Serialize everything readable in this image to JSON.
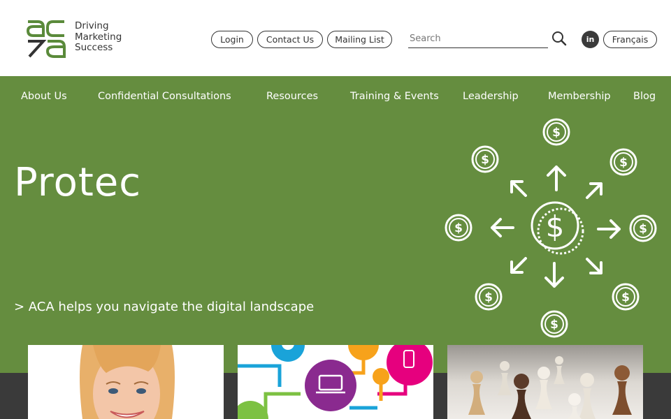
{
  "logo": {
    "lines": [
      "Driving",
      "Marketing",
      "Success"
    ]
  },
  "header": {
    "login_label": "Login",
    "contact_label": "Contact Us",
    "mailing_label": "Mailing List",
    "search_placeholder": "Search",
    "linkedin_text": "in",
    "language_label": "Français"
  },
  "nav": {
    "items": [
      "About Us",
      "Confidential Consultations",
      "Resources",
      "Training & Events",
      "Leadership",
      "Membership",
      "Blog"
    ]
  },
  "hero": {
    "title": "Protec",
    "subtitle": "> ACA helps you navigate the digital landscape",
    "dollar_symbol": "$"
  },
  "colors": {
    "brand_green": "#658d3f",
    "dark": "#3a3a3a",
    "text": "#333333"
  },
  "cards": [
    {
      "icon": "person-photo"
    },
    {
      "icon": "connected-devices-illustration"
    },
    {
      "icon": "wooden-pawns-photo"
    }
  ]
}
